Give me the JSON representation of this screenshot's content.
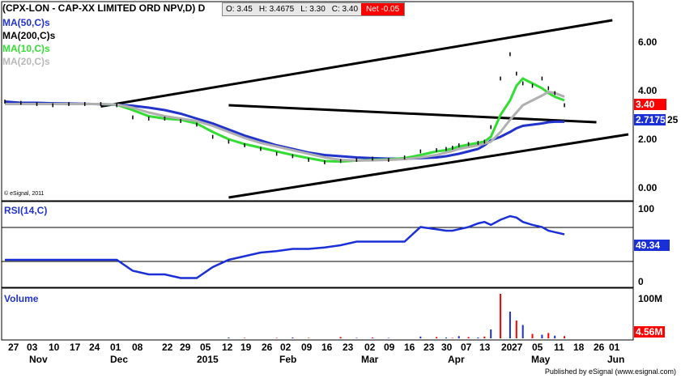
{
  "header": {
    "symbol_title": "(CPX-LON - CAP-XX LIMITED ORD NPV,D) D",
    "ohlc": {
      "open": "O: 3.45",
      "high": "H: 3.4675",
      "low": "L: 3.30",
      "close": "C: 3.40",
      "net": "Net -0.05"
    }
  },
  "legend": [
    {
      "label": "MA(50,C)s",
      "color": "#2233cc"
    },
    {
      "label": "MA(200,C)s",
      "color": "#000000"
    },
    {
      "label": "MA(10,C)s",
      "color": "#33dd33"
    },
    {
      "label": "MA(20,C)s",
      "color": "#b0b0b0"
    }
  ],
  "copyright": "© eSignal, 2011",
  "price_axis": {
    "ticks": [
      "6.00",
      "4.00",
      "2.00",
      "0.00"
    ],
    "values": [
      6,
      4,
      2,
      0
    ]
  },
  "price_tags": [
    {
      "label": "3.40",
      "bg": "#ff0000",
      "fg": "#ffffff",
      "value": 3.4
    },
    {
      "label": "2.7175",
      "bg": "#1a2fd6",
      "fg": "#ffffff",
      "value": 2.7175
    },
    {
      "label": "25",
      "bg": "#ffffff",
      "fg": "#000000",
      "value": 2.7175
    }
  ],
  "rsi": {
    "label": "RSI(14,C)",
    "ticks": [
      "100",
      "0"
    ],
    "current": "49.34"
  },
  "volume": {
    "label": "Volume",
    "ticks": [
      "100M"
    ],
    "current": "4.56M"
  },
  "x_axis": {
    "days": [
      "27",
      "03",
      "10",
      "17",
      "24",
      "01",
      "08",
      "22",
      "29",
      "05",
      "12",
      "19",
      "26",
      "02",
      "09",
      "16",
      "23",
      "02",
      "09",
      "16",
      "23",
      "30",
      "07",
      "13",
      "20",
      "27",
      "05",
      "11",
      "18",
      "26",
      "01"
    ],
    "months": [
      "Nov",
      "Dec",
      "2015",
      "Feb",
      "Mar",
      "Apr",
      "May",
      "Jun"
    ]
  },
  "footer": "Published by eSignal (www.esignal.com)",
  "chart_data": {
    "type": "line",
    "title": "(CPX-LON - CAP-XX LIMITED ORD NPV,D) D",
    "price": {
      "x_index": [
        0,
        5,
        10,
        15,
        20,
        25,
        30,
        35,
        40,
        45,
        50,
        55,
        60,
        65,
        70,
        75,
        80,
        85,
        90,
        95,
        100,
        105,
        110,
        115,
        120,
        125,
        130,
        135,
        138,
        140,
        142,
        145,
        148,
        150,
        152,
        155,
        158,
        160,
        162,
        165,
        168,
        170,
        172,
        175
      ],
      "close": [
        3.55,
        3.5,
        3.45,
        3.4,
        3.45,
        3.45,
        3.45,
        3.4,
        2.9,
        2.85,
        2.85,
        2.75,
        2.6,
        2.1,
        1.9,
        1.75,
        1.6,
        1.4,
        1.3,
        1.15,
        1.05,
        1.1,
        1.15,
        1.2,
        1.15,
        1.25,
        1.5,
        1.55,
        1.6,
        1.65,
        1.75,
        1.8,
        1.85,
        1.9,
        2.5,
        4.5,
        5.5,
        4.7,
        4.3,
        4.2,
        4.5,
        4.1,
        3.9,
        3.4
      ]
    },
    "ma_series": [
      {
        "name": "MA(50,C)s",
        "color": "#2233cc",
        "values": [
          3.55,
          3.5,
          3.5,
          3.48,
          3.47,
          3.46,
          3.44,
          3.42,
          3.38,
          3.3,
          3.2,
          3.05,
          2.85,
          2.65,
          2.4,
          2.15,
          1.95,
          1.75,
          1.6,
          1.45,
          1.35,
          1.3,
          1.25,
          1.22,
          1.2,
          1.2,
          1.22,
          1.25,
          1.3,
          1.35,
          1.4,
          1.5,
          1.6,
          1.75,
          1.95,
          2.1,
          2.3,
          2.45,
          2.55,
          2.6,
          2.65,
          2.7,
          2.72,
          2.72
        ]
      },
      {
        "name": "MA(10,C)s",
        "color": "#33dd33",
        "values": [
          3.45,
          3.45,
          3.45,
          3.45,
          3.45,
          3.45,
          3.45,
          3.42,
          3.2,
          2.95,
          2.85,
          2.8,
          2.65,
          2.3,
          2.0,
          1.8,
          1.65,
          1.5,
          1.35,
          1.22,
          1.1,
          1.08,
          1.12,
          1.15,
          1.17,
          1.22,
          1.35,
          1.5,
          1.55,
          1.62,
          1.7,
          1.78,
          1.85,
          1.9,
          2.1,
          3.0,
          3.6,
          4.2,
          4.5,
          4.3,
          4.1,
          3.9,
          3.75,
          3.6
        ]
      },
      {
        "name": "MA(20,C)s",
        "color": "#b0b0b0",
        "values": [
          3.45,
          3.45,
          3.45,
          3.45,
          3.45,
          3.45,
          3.45,
          3.43,
          3.3,
          3.1,
          2.95,
          2.85,
          2.75,
          2.55,
          2.3,
          2.05,
          1.85,
          1.7,
          1.55,
          1.4,
          1.25,
          1.15,
          1.12,
          1.13,
          1.15,
          1.18,
          1.25,
          1.35,
          1.45,
          1.52,
          1.6,
          1.68,
          1.75,
          1.82,
          1.9,
          2.3,
          2.8,
          3.1,
          3.4,
          3.6,
          3.8,
          3.95,
          3.9,
          3.75
        ]
      }
    ],
    "trendlines": [
      {
        "x": [
          30,
          190
        ],
        "y": [
          3.35,
          6.9
        ]
      },
      {
        "x": [
          70,
          195
        ],
        "y": [
          -0.4,
          2.2
        ]
      },
      {
        "x": [
          70,
          185
        ],
        "y": [
          3.4,
          2.7
        ]
      }
    ],
    "rsi_values": [
      30,
      30,
      30,
      30,
      30,
      30,
      30,
      30,
      15,
      10,
      10,
      5,
      5,
      20,
      30,
      35,
      40,
      42,
      45,
      45,
      47,
      50,
      55,
      55,
      55,
      55,
      75,
      72,
      70,
      70,
      72,
      75,
      80,
      82,
      78,
      85,
      90,
      88,
      82,
      78,
      75,
      70,
      68,
      65
    ],
    "volume_values": [
      0,
      0,
      0,
      0,
      0,
      0,
      0,
      0,
      0,
      0,
      0,
      0,
      0,
      0,
      2,
      1,
      0,
      1,
      2,
      1,
      0,
      3,
      1,
      2,
      1,
      0,
      4,
      3,
      2,
      1,
      5,
      3,
      2,
      4,
      20,
      100,
      60,
      40,
      30,
      10,
      8,
      12,
      6,
      5
    ],
    "ylim": [
      -0.5,
      7.0
    ]
  }
}
